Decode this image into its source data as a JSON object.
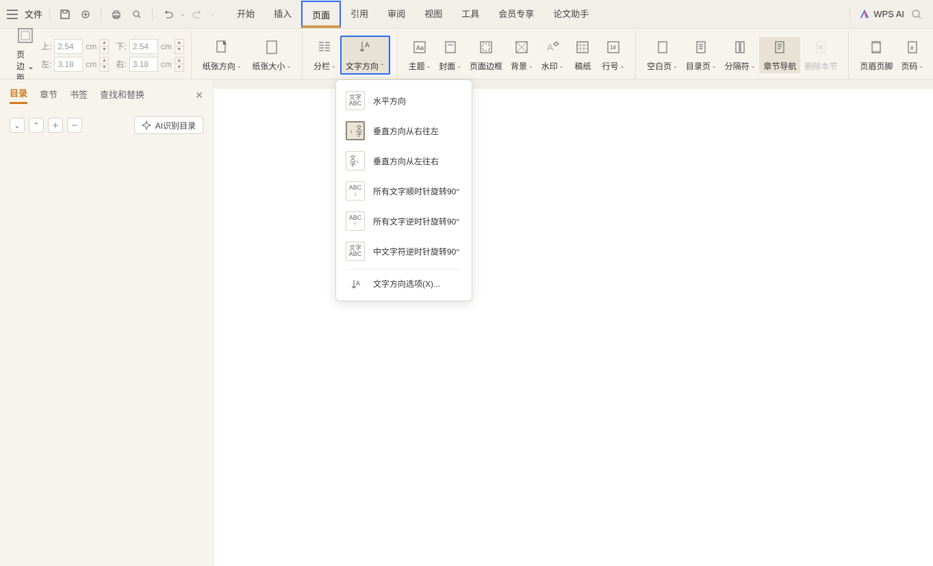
{
  "menubar": {
    "file": "文件",
    "items": [
      "开始",
      "插入",
      "页面",
      "引用",
      "审阅",
      "视图",
      "工具",
      "会员专享",
      "论文助手"
    ],
    "active_index": 2,
    "wps_ai": "WPS AI"
  },
  "ribbon": {
    "page_margin": {
      "label": "页边距"
    },
    "margins": {
      "top_label": "上:",
      "top_val": "2.54",
      "unit": "cm",
      "bottom_label": "下:",
      "bottom_val": "2.54",
      "left_label": "左:",
      "left_val": "3.18",
      "right_label": "右:",
      "right_val": "3.18"
    },
    "paper_orient": "纸张方向",
    "paper_size": "纸张大小",
    "columns": "分栏",
    "text_dir": "文字方向",
    "theme": "主题",
    "cover": "封面",
    "page_border": "页面边框",
    "background": "背景",
    "watermark": "水印",
    "grid_paper": "稿纸",
    "line_num": "行号",
    "blank_page": "空白页",
    "toc_page": "目录页",
    "separator": "分隔符",
    "chapter_nav": "章节导航",
    "delete_section": "删除本节",
    "header_footer": "页眉页脚",
    "page_number": "页码"
  },
  "dropdown": {
    "items": [
      "水平方向",
      "垂直方向从右往左",
      "垂直方向从左往右",
      "所有文字顺时针旋转90°",
      "所有文字逆时针旋转90°",
      "中文字符逆时针旋转90°"
    ],
    "selected": 1,
    "more": "文字方向选项(X)..."
  },
  "sidepanel": {
    "tabs": [
      "目录",
      "章节",
      "书签",
      "查找和替换"
    ],
    "active_tab": 0,
    "ai_btn": "AI识别目录"
  }
}
